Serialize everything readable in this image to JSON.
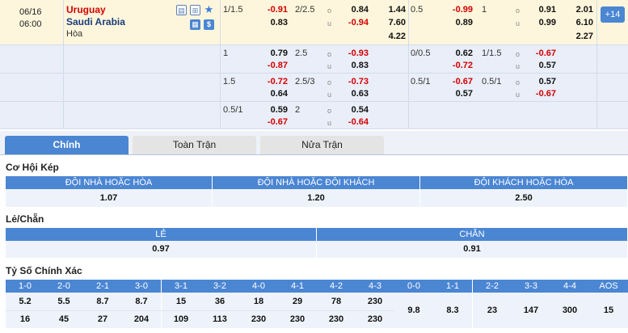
{
  "match": {
    "date": "06/16",
    "time": "06:00",
    "home": "Uruguay",
    "away": "Saudi Arabia",
    "draw": "Hòa",
    "more_count": "14",
    "icons": [
      "document-icon",
      "grid-icon",
      "star-icon",
      "calendar-icon",
      "dollar-icon"
    ]
  },
  "odds_rows": [
    {
      "ft_hcap": "1/1.5",
      "ft_h": [
        "-0.91",
        "0.83"
      ],
      "ft_ou": "2/2.5",
      "ft_ou_v": [
        "0.84",
        "-0.94"
      ],
      "ft_ou_l": [
        "o",
        "u"
      ],
      "ft_1x2": [
        "1.44",
        "7.60",
        "4.22"
      ],
      "ht_hcap": "0.5",
      "ht_h": [
        "-0.99",
        "0.89"
      ],
      "ht_ou": "1",
      "ht_ou_v": [
        "0.91",
        "0.99"
      ],
      "ht_ou_l": [
        "o",
        "u"
      ],
      "ht_1x2": [
        "2.01",
        "6.10",
        "2.27"
      ]
    },
    {
      "ft_hcap": "1",
      "ft_h": [
        "0.79",
        "-0.87"
      ],
      "ft_ou": "2.5",
      "ft_ou_v": [
        "-0.93",
        "0.83"
      ],
      "ft_ou_l": [
        "o",
        "u"
      ],
      "ht_hcap": "0/0.5",
      "ht_h": [
        "0.62",
        "-0.72"
      ],
      "ht_ou": "1/1.5",
      "ht_ou_v": [
        "-0.67",
        "0.57"
      ],
      "ht_ou_l": [
        "o",
        "u"
      ]
    },
    {
      "ft_hcap": "1.5",
      "ft_h": [
        "-0.72",
        "0.64"
      ],
      "ft_ou": "2.5/3",
      "ft_ou_v": [
        "-0.73",
        "0.63"
      ],
      "ft_ou_l": [
        "o",
        "u"
      ],
      "ht_hcap": "0.5/1",
      "ht_h": [
        "-0.67",
        "0.57"
      ],
      "ht_ou": "0.5/1",
      "ht_ou_v": [
        "0.57",
        "-0.67"
      ],
      "ht_ou_l": [
        "o",
        "u"
      ]
    },
    {
      "ft_hcap": "0.5/1",
      "ft_h": [
        "0.59",
        "-0.67"
      ],
      "ft_ou": "2",
      "ft_ou_v": [
        "0.54",
        "-0.64"
      ],
      "ft_ou_l": [
        "o",
        "u"
      ]
    }
  ],
  "tabs": [
    "Chính",
    "Toàn Trận",
    "Nửa Trận"
  ],
  "double_chance": {
    "title": "Cơ Hội Kép",
    "headers": [
      "ĐỘI NHÀ HOẶC HÒA",
      "ĐỘI NHÀ HOẶC ĐỘI KHÁCH",
      "ĐỘI KHÁCH HOẶC HÒA"
    ],
    "values": [
      "1.07",
      "1.20",
      "2.50"
    ]
  },
  "odd_even": {
    "title": "Lẻ/Chẵn",
    "headers": [
      "LẺ",
      "CHẴN"
    ],
    "values": [
      "0.97",
      "0.91"
    ]
  },
  "correct_score": {
    "title": "Tỷ Số Chính Xác",
    "headers": [
      "1-0",
      "2-0",
      "2-1",
      "3-0",
      "3-1",
      "3-2",
      "4-0",
      "4-1",
      "4-2",
      "4-3",
      "0-0",
      "1-1",
      "2-2",
      "3-3",
      "4-4",
      "AOS"
    ],
    "home_row": [
      "5.2",
      "5.5",
      "8.7",
      "8.7",
      "15",
      "36",
      "18",
      "29",
      "78",
      "230"
    ],
    "away_row": [
      "16",
      "45",
      "27",
      "204",
      "109",
      "113",
      "230",
      "230",
      "230",
      "230"
    ],
    "draw_row": [
      "9.8",
      "8.3",
      "23",
      "147",
      "300",
      "15"
    ]
  },
  "colors": {
    "accent": "#4b86d3",
    "negative": "#d40000",
    "home_team": "#d40000",
    "away_team": "#1a3d7a",
    "row_highlight": "#fdf6dc"
  }
}
